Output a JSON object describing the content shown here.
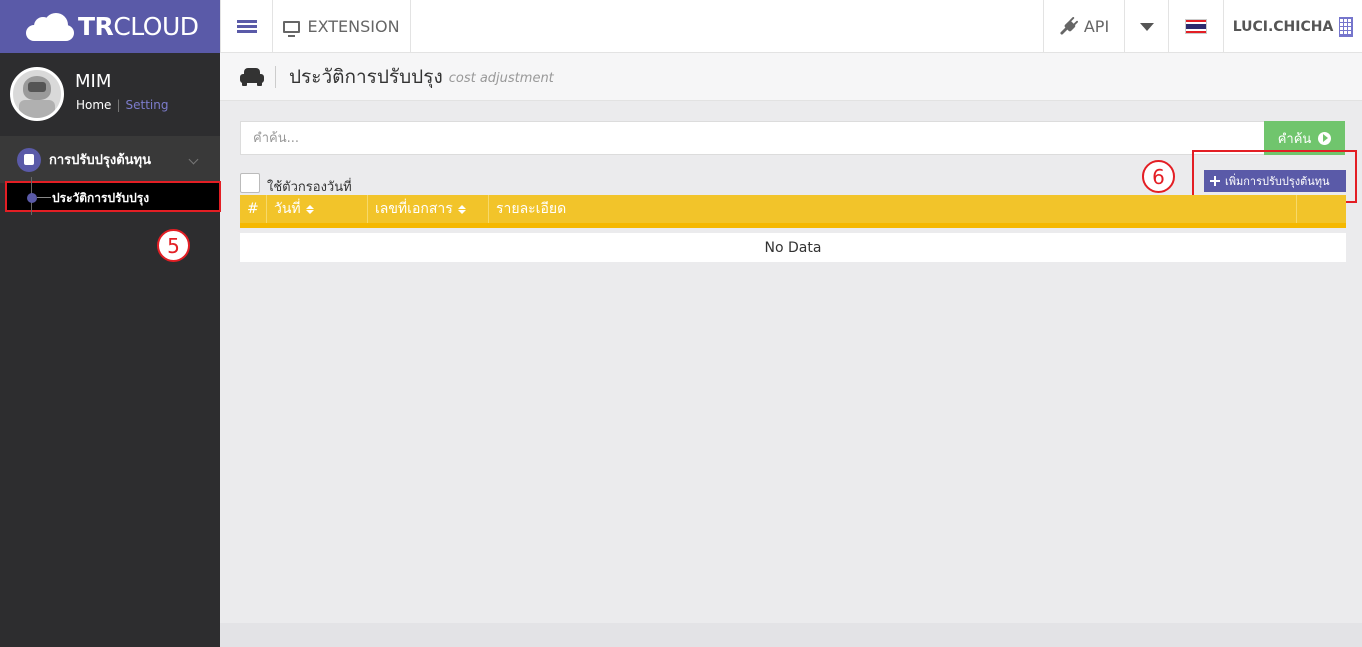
{
  "brand": {
    "name_bold": "TR",
    "name_rest": "CLOUD"
  },
  "topbar": {
    "extension_label": "EXTENSION",
    "api_label": "API",
    "user_label": "LUCI.CHICHA",
    "flag_colors": [
      "#e31e24",
      "#ffffff",
      "#2d2a6e",
      "#ffffff",
      "#e31e24"
    ]
  },
  "sidebar": {
    "profile_name": "MIM",
    "home_link": "Home",
    "separator": "|",
    "setting_link": "Setting",
    "group_label": "การปรับปรุงต้นทุน",
    "sub_item_label": "ประวัติการปรับปรุง"
  },
  "annotations": {
    "badge_5": "5",
    "badge_6": "6"
  },
  "page": {
    "title": "ประวัติการปรับปรุง",
    "subtitle": "cost adjustment"
  },
  "search": {
    "placeholder": "คำค้น...",
    "button_label": "คำค้น"
  },
  "filter": {
    "label": "ใช้ตัวกรองวันที่",
    "checked": false
  },
  "add_button_label": "เพิ่มการปรับปรุงต้นทุน",
  "table": {
    "headers": [
      "#",
      "วันที่",
      "เลขที่เอกสาร",
      "รายละเอียด",
      ""
    ],
    "empty_text": "No Data"
  },
  "colors": {
    "brand": "#5a5aa8",
    "search_button": "#70c56d",
    "table_header": "#f2c42a",
    "highlight": "#e31e24"
  }
}
